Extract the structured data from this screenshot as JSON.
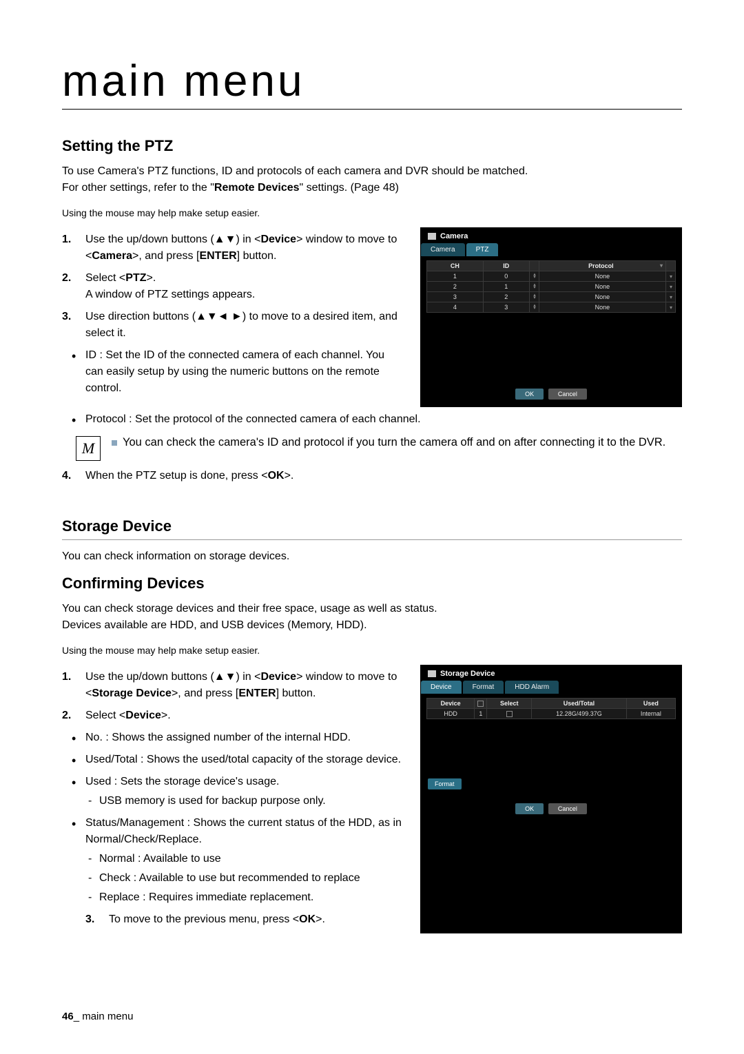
{
  "page": {
    "main_title": "main menu",
    "footer_num": "46",
    "footer_text": "main menu"
  },
  "s1": {
    "heading": "Setting the PTZ",
    "intro1": "To use Camera's PTZ functions, ID and protocols of each camera and DVR should be matched.",
    "intro2_a": "For other settings, refer to the \"",
    "intro2_b": "Remote Devices",
    "intro2_c": "\" settings. (Page 48)",
    "helper": "Using the mouse may help make setup easier.",
    "steps": {
      "s1a": "Use the up/down buttons (▲▼) in <",
      "s1b": "Device",
      "s1c": "> window to move to <",
      "s1d": "Camera",
      "s1e": ">, and press [",
      "s1f": "ENTER",
      "s1g": "] button.",
      "s2a": "Select <",
      "s2b": "PTZ",
      "s2c": ">.",
      "s2d": "A window of PTZ settings appears.",
      "s3": "Use direction buttons (▲▼◄ ►) to move to a desired item, and select it.",
      "b1": "ID : Set the ID of the connected camera of each channel. You can easily setup by using the numeric buttons on the remote control.",
      "b2": "Protocol : Set the protocol of the connected camera of each channel.",
      "note": "You can check the camera's ID and protocol if you turn the camera off and on after connecting it to the DVR.",
      "s4a": "When the PTZ setup is done, press <",
      "s4b": "OK",
      "s4c": ">."
    },
    "n1": "1.",
    "n2": "2.",
    "n3": "3.",
    "n4": "4."
  },
  "dlg1": {
    "title": "Camera",
    "tab1": "Camera",
    "tab2": "PTZ",
    "th_ch": "CH",
    "th_id": "ID",
    "th_proto": "Protocol",
    "rows": [
      {
        "ch": "1",
        "id": "0",
        "proto": "None"
      },
      {
        "ch": "2",
        "id": "1",
        "proto": "None"
      },
      {
        "ch": "3",
        "id": "2",
        "proto": "None"
      },
      {
        "ch": "4",
        "id": "3",
        "proto": "None"
      }
    ],
    "ok": "OK",
    "cancel": "Cancel"
  },
  "s2": {
    "heading": "Storage Device",
    "intro": "You can check information on storage devices.",
    "sub": "Confirming Devices",
    "intro2": "You can check storage devices and their free space, usage as well as status.",
    "intro3": "Devices available are HDD, and USB devices (Memory, HDD).",
    "helper": "Using the mouse may help make setup easier.",
    "steps": {
      "s1a": "Use the up/down buttons (▲▼) in <",
      "s1b": "Device",
      "s1c": "> window to move to <",
      "s1d": "Storage Device",
      "s1e": ">, and press [",
      "s1f": "ENTER",
      "s1g": "] button.",
      "s2a": "Select <",
      "s2b": "Device",
      "s2c": ">.",
      "b1": "No. : Shows the assigned number of the internal HDD.",
      "b2": "Used/Total : Shows the used/total capacity of the storage device.",
      "b3": "Used : Sets the storage device's usage.",
      "b3s": "USB memory is used for backup purpose only.",
      "b4": "Status/Management : Shows the current status of the HDD, as in Normal/Check/Replace.",
      "b4s1": "Normal : Available to use",
      "b4s2": "Check : Available to use but recommended to replace",
      "b4s3": "Replace : Requires immediate replacement.",
      "s3a": "To move to the previous menu, press <",
      "s3b": "OK",
      "s3c": ">."
    },
    "n1": "1.",
    "n2": "2.",
    "n3": "3."
  },
  "dlg2": {
    "title": "Storage Device",
    "tab1": "Device",
    "tab2": "Format",
    "tab3": "HDD Alarm",
    "th_dev": "Device",
    "th_sel": "Select",
    "th_ut": "Used/Total",
    "th_used": "Used",
    "row": {
      "dev": "HDD",
      "no": "1",
      "ut": "12.28G/499.37G",
      "used": "Internal"
    },
    "format": "Format",
    "ok": "OK",
    "cancel": "Cancel"
  },
  "note_icon": "M"
}
